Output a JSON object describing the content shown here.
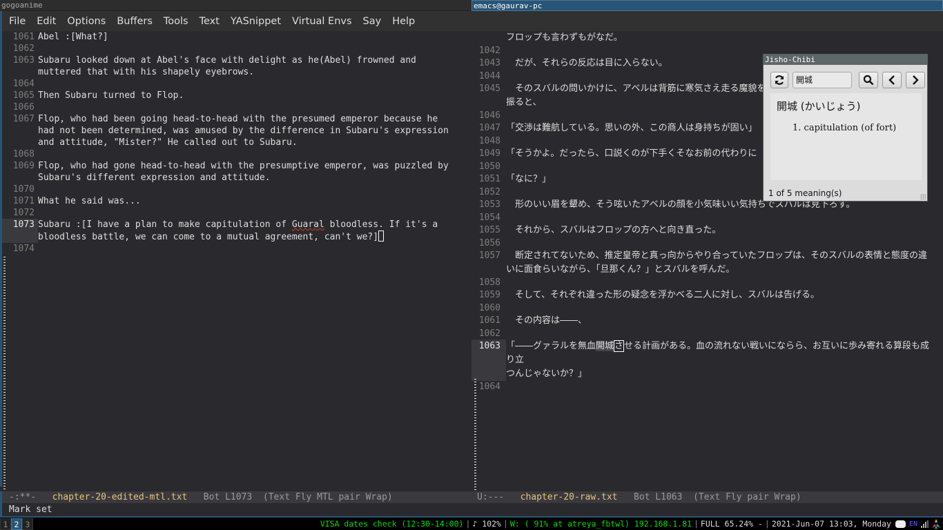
{
  "left_frame": {
    "title": "gogoanime",
    "menu": [
      "File",
      "Edit",
      "Options",
      "Buffers",
      "Tools",
      "Text",
      "YASnippet",
      "Virtual Envs",
      "Say",
      "Help"
    ],
    "lines": [
      {
        "num": "1061",
        "text": "Abel :[What?]"
      },
      {
        "num": "1062",
        "text": ""
      },
      {
        "num": "1063",
        "text": "Subaru looked down at Abel's face with delight as he(Abel) frowned and\nmuttered that with his shapely eyebrows."
      },
      {
        "num": "1064",
        "text": ""
      },
      {
        "num": "1065",
        "text": "Then Subaru turned to Flop."
      },
      {
        "num": "1066",
        "text": ""
      },
      {
        "num": "1067",
        "text": "Flop, who had been going head-to-head with the presumed emperor because he\nhad not been determined, was amused by the difference in Subaru's expression\nand attitude, \"Mister?\" He called out to Subaru."
      },
      {
        "num": "1068",
        "text": ""
      },
      {
        "num": "1069",
        "text": "Flop, who had gone head-to-head with the presumptive emperor, was puzzled by\nSubaru's different expression and attitude."
      },
      {
        "num": "1070",
        "text": ""
      },
      {
        "num": "1071",
        "text": "What he said was..."
      },
      {
        "num": "1072",
        "text": ""
      },
      {
        "num": "1074",
        "text": ""
      }
    ],
    "current_line": {
      "num": "1073",
      "before": "Subaru :[I have a plan to make capitulation of ",
      "misspelled": "Guaral",
      "after": " bloodless. If it's a\nbloodless battle, we can come to a mutual agreement, can't we?]"
    },
    "modeline": {
      "state": "-:**-",
      "file": "chapter-20-edited-mtl.txt",
      "pos": "Bot L1073",
      "modes": "(Text Fly MTL pair Wrap)"
    },
    "minibuffer": "Mark set"
  },
  "right_frame": {
    "title": "emacs@gaurav-pc",
    "lines_top": [
      {
        "num": "",
        "text": "フロップも言わずもがなだ。"
      },
      {
        "num": "1042",
        "text": ""
      },
      {
        "num": "1043",
        "text": "　だが、それらの反応は目に入らない。"
      },
      {
        "num": "1044",
        "text": ""
      },
      {
        "num": "1045",
        "text": "　そのスバルの問いかけに、アベルは背筋に寒気さえ走る魔貌を歪めて首を横に\n振ると、"
      },
      {
        "num": "1046",
        "text": ""
      },
      {
        "num": "1047",
        "text": "「交渉は難航している。思いの外、この商人は身持ちが固い」"
      },
      {
        "num": "1048",
        "text": ""
      },
      {
        "num": "1049",
        "text": "「そうかよ。だったら、口説くのが下手くそなお前の代わりに"
      },
      {
        "num": "1050",
        "text": ""
      },
      {
        "num": "1051",
        "text": "「なに？」"
      },
      {
        "num": "1052",
        "text": ""
      },
      {
        "num": "1053",
        "text": "　形のいい眉を顰め、そう呟いたアベルの顔を小気味いい気持ちでスバルは見下ろす。"
      },
      {
        "num": "1054",
        "text": ""
      },
      {
        "num": "1055",
        "text": "　それから、スバルはフロップの方へと向き直った。"
      },
      {
        "num": "1056",
        "text": ""
      },
      {
        "num": "1057",
        "text": "　断定されてないため、推定皇帝と真っ向からやり合っていたフロップは、そのスバルの表情と態度の違\nいに面食らいながら、「旦那くん？」とスバルを呼んだ。"
      },
      {
        "num": "1058",
        "text": ""
      },
      {
        "num": "1059",
        "text": "　そして、それぞれ違った形の疑念を浮かべる二人に対し、スバルは告げる。"
      },
      {
        "num": "1060",
        "text": ""
      },
      {
        "num": "1061",
        "text": "　その内容は――、"
      },
      {
        "num": "1062",
        "text": ""
      }
    ],
    "current_line": {
      "num": "1063",
      "before": "「――グァラルを無血",
      "highlight": "開城",
      "cursor_char": "さ",
      "after": "せる計画がある。血の流れない戦いにならら、お互いに歩み寄れる算段も成り立\nつんじゃないか？」"
    },
    "last_line": {
      "num": "1064",
      "text": ""
    },
    "modeline": {
      "state": "U:---",
      "file": "chapter-20-raw.txt",
      "pos": "Bot L1063",
      "modes": "(Text Fly pair Wrap)"
    }
  },
  "jisho": {
    "title": "Jisho-Chibi",
    "query": "開城",
    "word": "開城 (かいじょう)",
    "meaning": "1. capitulation (of fort)",
    "status": "1 of 5 meaning(s)",
    "icons": {
      "refresh": "⟳",
      "search": "🔍",
      "prev": "<",
      "next": ">"
    }
  },
  "taskbar": {
    "workspaces": [
      "1",
      "2",
      "3"
    ],
    "active_workspace": "2",
    "reminder": "VISA dates check (12:30-14:00)",
    "volume": "♪ 102%",
    "wifi": "W: ( 91% at atreya_fbtwl) 192.168.1.81",
    "battery": "FULL 65.24% -",
    "datetime": "2021-Jun-07 13:03, Monday",
    "lang": "EN"
  }
}
